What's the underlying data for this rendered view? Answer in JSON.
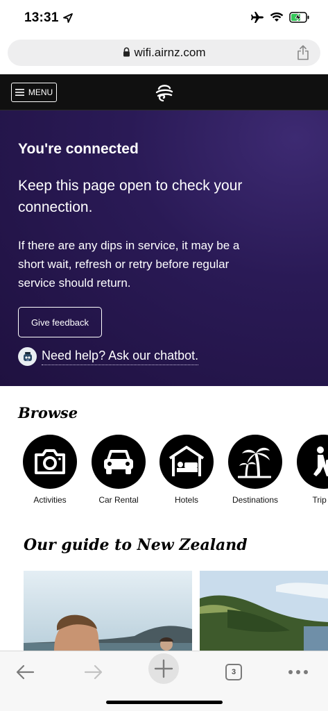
{
  "status_bar": {
    "time": "13:31",
    "icons": [
      "location-arrow-icon",
      "airplane-icon",
      "wifi-icon",
      "battery-charging-icon"
    ]
  },
  "browser": {
    "url": "wifi.airnz.com",
    "tab_count": "3"
  },
  "site_header": {
    "menu_label": "MENU"
  },
  "hero": {
    "title": "You're connected",
    "lead": "Keep this page open to check your connection.",
    "body": "If there are any dips in service, it may be a short wait, refresh or retry before regular service should return.",
    "feedback_button": "Give feedback",
    "chatbot_link": "Need help? Ask our chatbot."
  },
  "browse": {
    "title": "Browse",
    "items": [
      {
        "label": "Activities",
        "icon": "camera-icon"
      },
      {
        "label": "Car Rental",
        "icon": "car-icon"
      },
      {
        "label": "Hotels",
        "icon": "hotel-bed-icon"
      },
      {
        "label": "Destinations",
        "icon": "palm-trees-icon"
      },
      {
        "label": "Trip id",
        "icon": "traveller-icon"
      }
    ]
  },
  "guide": {
    "title": "Our guide to New Zealand"
  },
  "colors": {
    "hero_bg": "#2a1a56",
    "header_bg": "#101010"
  }
}
